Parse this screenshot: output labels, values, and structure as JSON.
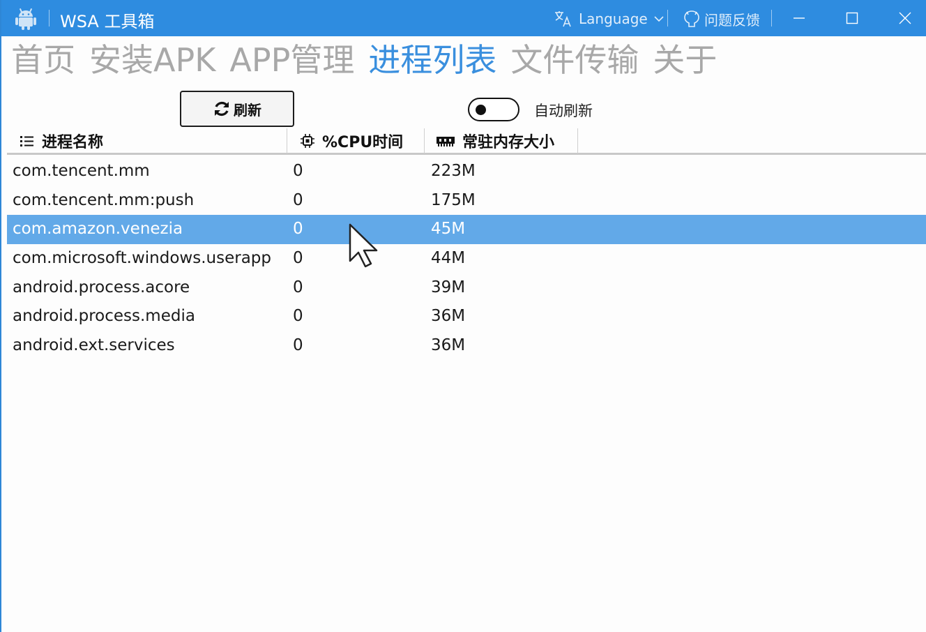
{
  "window": {
    "title": "WSA 工具箱",
    "accent_color": "#2e8ce0",
    "app_icon": "android-icon",
    "language_label": "Language",
    "feedback_label": "问题反馈"
  },
  "nav": {
    "tabs": [
      {
        "label": "首页",
        "active": false
      },
      {
        "label": "安装APK",
        "active": false
      },
      {
        "label": "APP管理",
        "active": false
      },
      {
        "label": "进程列表",
        "active": true
      },
      {
        "label": "文件传输",
        "active": false
      },
      {
        "label": "关于",
        "active": false
      }
    ],
    "active_color": "#3a8fde"
  },
  "controls": {
    "refresh_label": "刷新",
    "auto_refresh_label": "自动刷新",
    "auto_refresh_on": false
  },
  "table": {
    "columns": [
      {
        "label": "进程名称",
        "icon": "list-icon"
      },
      {
        "label": "%CPU时间",
        "icon": "cpu-icon"
      },
      {
        "label": "常驻内存大小",
        "icon": "memory-icon"
      }
    ],
    "rows": [
      {
        "name": "com.tencent.mm",
        "cpu": "0",
        "mem": "223M",
        "selected": false
      },
      {
        "name": "com.tencent.mm:push",
        "cpu": "0",
        "mem": "175M",
        "selected": false
      },
      {
        "name": "com.amazon.venezia",
        "cpu": "0",
        "mem": "45M",
        "selected": true
      },
      {
        "name": "com.microsoft.windows.userapp",
        "cpu": "0",
        "mem": "44M",
        "selected": false
      },
      {
        "name": "android.process.acore",
        "cpu": "0",
        "mem": "39M",
        "selected": false
      },
      {
        "name": "android.process.media",
        "cpu": "0",
        "mem": "36M",
        "selected": false
      },
      {
        "name": "android.ext.services",
        "cpu": "0",
        "mem": "36M",
        "selected": false
      }
    ],
    "selected_color": "#62a9e8"
  }
}
